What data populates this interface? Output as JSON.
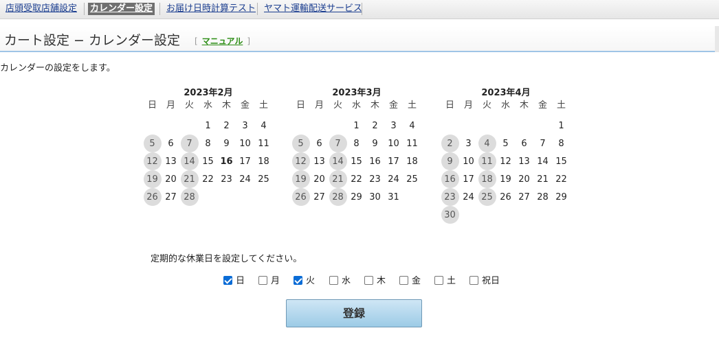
{
  "nav": {
    "items": [
      "店頭受取店舗設定",
      "カレンダー設定",
      "お届け日時計算テスト",
      "ヤマト運輸配送サービス"
    ]
  },
  "header": {
    "title": "カート設定 − カレンダー設定",
    "bracket_open": "[",
    "manual_label": "マニュアル",
    "bracket_close": "]"
  },
  "description": "カレンダーの設定をします。",
  "weekdays": [
    "日",
    "月",
    "火",
    "水",
    "木",
    "金",
    "土"
  ],
  "calendars": [
    {
      "title": "2023年2月",
      "weeks": [
        [
          "",
          "",
          "",
          "1",
          "2",
          "3",
          "4"
        ],
        [
          "5",
          "6",
          "7",
          "8",
          "9",
          "10",
          "11"
        ],
        [
          "12",
          "13",
          "14",
          "15",
          "16",
          "17",
          "18"
        ],
        [
          "19",
          "20",
          "21",
          "22",
          "23",
          "24",
          "25"
        ],
        [
          "26",
          "27",
          "28",
          "",
          "",
          "",
          ""
        ]
      ],
      "today": "16"
    },
    {
      "title": "2023年3月",
      "weeks": [
        [
          "",
          "",
          "",
          "1",
          "2",
          "3",
          "4"
        ],
        [
          "5",
          "6",
          "7",
          "8",
          "9",
          "10",
          "11"
        ],
        [
          "12",
          "13",
          "14",
          "15",
          "16",
          "17",
          "18"
        ],
        [
          "19",
          "20",
          "21",
          "22",
          "23",
          "24",
          "25"
        ],
        [
          "26",
          "27",
          "28",
          "29",
          "30",
          "31",
          ""
        ]
      ],
      "today": ""
    },
    {
      "title": "2023年4月",
      "weeks": [
        [
          "",
          "",
          "",
          "",
          "",
          "",
          "1"
        ],
        [
          "2",
          "3",
          "4",
          "5",
          "6",
          "7",
          "8"
        ],
        [
          "9",
          "10",
          "11",
          "12",
          "13",
          "14",
          "15"
        ],
        [
          "16",
          "17",
          "18",
          "19",
          "20",
          "21",
          "22"
        ],
        [
          "23",
          "24",
          "25",
          "26",
          "27",
          "28",
          "29"
        ],
        [
          "30",
          "",
          "",
          "",
          "",
          "",
          ""
        ]
      ],
      "today": ""
    }
  ],
  "holiday_prompt": "定期的な休業日を設定してください。",
  "holiday_options": [
    {
      "label": "日",
      "checked": true
    },
    {
      "label": "月",
      "checked": false
    },
    {
      "label": "火",
      "checked": true
    },
    {
      "label": "水",
      "checked": false
    },
    {
      "label": "木",
      "checked": false
    },
    {
      "label": "金",
      "checked": false
    },
    {
      "label": "土",
      "checked": false
    },
    {
      "label": "祝日",
      "checked": false
    }
  ],
  "submit_label": "登録"
}
